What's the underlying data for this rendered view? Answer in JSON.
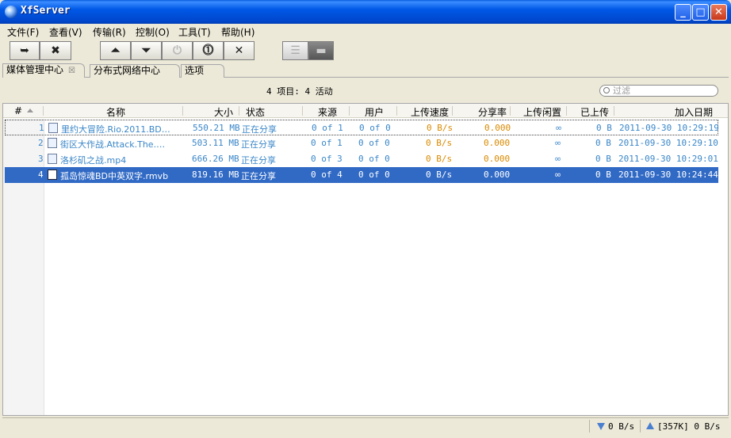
{
  "window": {
    "title": "XfServer"
  },
  "menu": [
    "文件(F)",
    "查看(V)",
    "传输(R)",
    "控制(O)",
    "工具(T)",
    "帮助(H)"
  ],
  "toolbar": {
    "icons": [
      "add-torrent-icon",
      "preferences-icon",
      "move-up-icon",
      "move-down-icon",
      "power-icon",
      "stop-icon",
      "remove-icon",
      "list-view-icon",
      "detail-view-icon"
    ]
  },
  "tabs": [
    {
      "label": "媒体管理中心",
      "active": true
    },
    {
      "label": "分布式网络中心",
      "active": false
    },
    {
      "label": "选项",
      "active": false
    }
  ],
  "info": {
    "summary": "4 项目: 4 活动"
  },
  "filter": {
    "placeholder": "过滤"
  },
  "columns": [
    "#",
    "名称",
    "大小",
    "状态",
    "来源",
    "用户",
    "上传速度",
    "分享率",
    "上传闲置",
    "已上传",
    "加入日期"
  ],
  "rows": [
    {
      "num": "1",
      "name": "里约大冒险.Rio.2011.BD…",
      "size": "550.21 MB",
      "status": "正在分享",
      "source": "0 of 1",
      "users": "0 of 0",
      "upspeed": "0 B/s",
      "ratio": "0.000",
      "idle": "∞",
      "uploaded": "0 B",
      "date": "2011-09-30 10:29:19"
    },
    {
      "num": "2",
      "name": "街区大作战.Attack.The.…",
      "size": "503.11 MB",
      "status": "正在分享",
      "source": "0 of 1",
      "users": "0 of 0",
      "upspeed": "0 B/s",
      "ratio": "0.000",
      "idle": "∞",
      "uploaded": "0 B",
      "date": "2011-09-30 10:29:10"
    },
    {
      "num": "3",
      "name": "洛杉矶之战.mp4",
      "size": "666.26 MB",
      "status": "正在分享",
      "source": "0 of 3",
      "users": "0 of 0",
      "upspeed": "0 B/s",
      "ratio": "0.000",
      "idle": "∞",
      "uploaded": "0 B",
      "date": "2011-09-30 10:29:01"
    },
    {
      "num": "4",
      "name": "孤岛惊魂BD中英双字.rmvb",
      "size": "819.16 MB",
      "status": "正在分享",
      "source": "0 of 4",
      "users": "0 of 0",
      "upspeed": "0 B/s",
      "ratio": "0.000",
      "idle": "∞",
      "uploaded": "0 B",
      "date": "2011-09-30 10:24:44"
    }
  ],
  "status": {
    "down": "0 B/s",
    "up": "[357K] 0 B/s"
  }
}
